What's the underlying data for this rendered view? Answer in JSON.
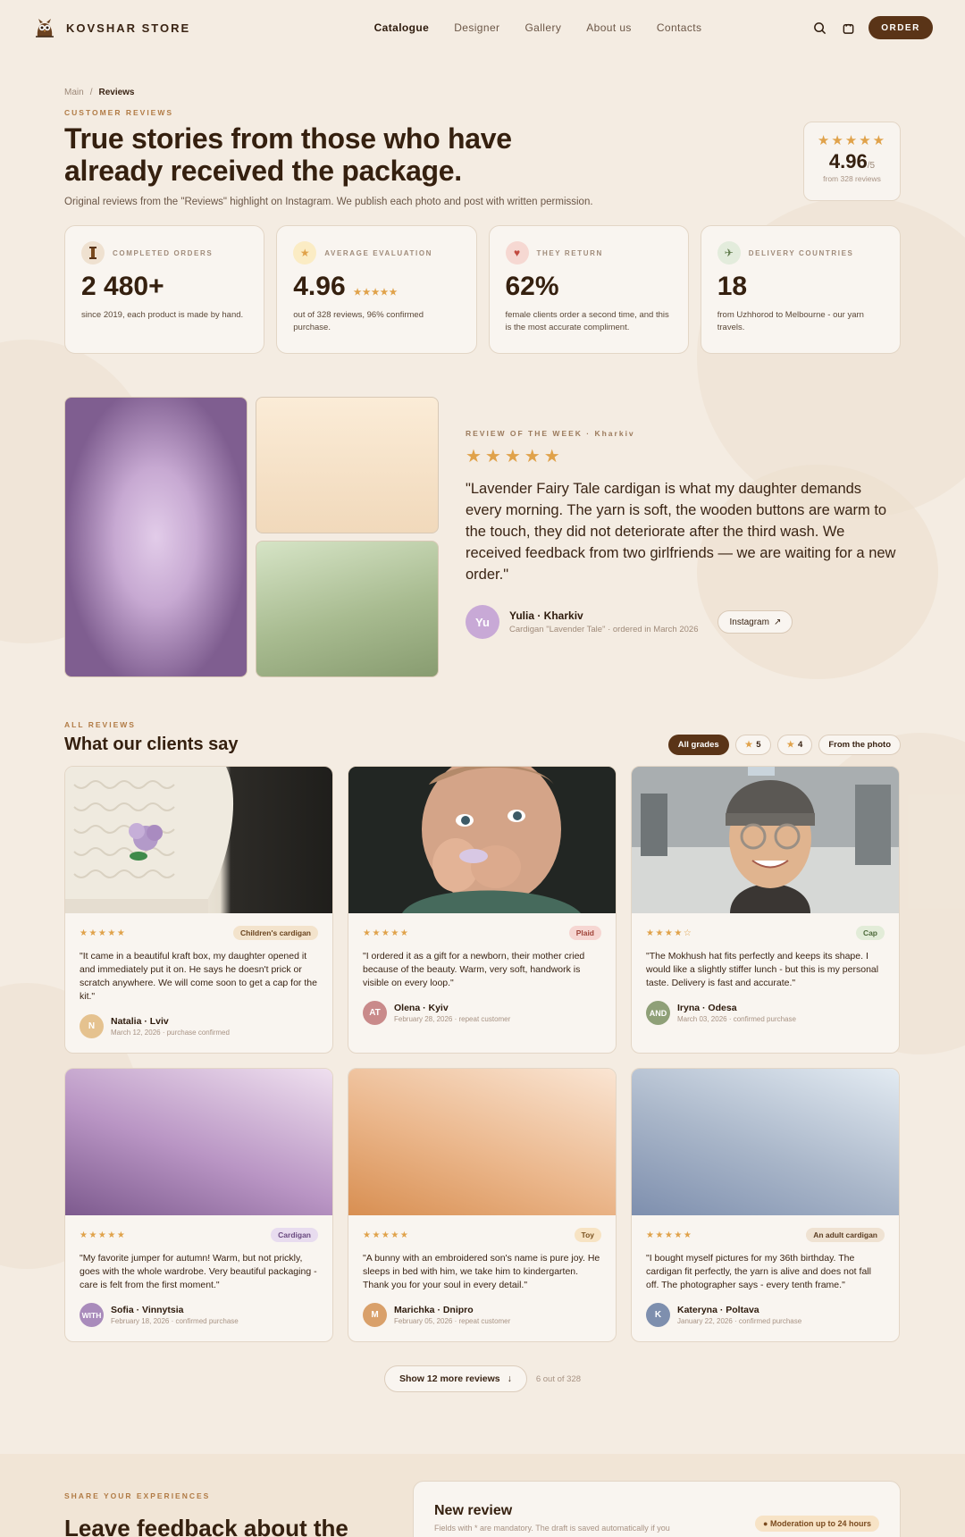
{
  "header": {
    "brand": "KOVSHAR STORE",
    "nav": [
      "Catalogue",
      "Designer",
      "Gallery",
      "About us",
      "Contacts"
    ],
    "nav_active": "Catalogue",
    "order_label": "ORDER"
  },
  "breadcrumb": {
    "home": "Main",
    "separator": "/",
    "current": "Reviews"
  },
  "hero": {
    "eyebrow": "CUSTOMER REVIEWS",
    "title": "True stories from those who have already received the package.",
    "subtitle": "Original reviews from the \"Reviews\" highlight on Instagram. We publish each photo and post with written permission.",
    "rating": {
      "stars": "★★★★★",
      "value": "4.96",
      "of": "/5",
      "from": "from 328 reviews"
    }
  },
  "stats": [
    {
      "label": "COMPLETED ORDERS",
      "value": "2 480+",
      "desc": "since 2019, each product is made by hand.",
      "icon": "spool-icon",
      "icon_bg": "#efe1d0"
    },
    {
      "label": "AVERAGE EVALUATION",
      "value": "4.96",
      "mini_stars": "★★★★★",
      "desc": "out of 328 reviews, 96% confirmed purchase.",
      "icon": "star-icon",
      "icon_bg": "#fbecc4"
    },
    {
      "label": "THEY RETURN",
      "value": "62%",
      "desc": "female clients order a second time, and this is the most accurate compliment.",
      "icon": "heart-icon",
      "icon_bg": "#f6d8d2"
    },
    {
      "label": "DELIVERY COUNTRIES",
      "value": "18",
      "desc": "from Uzhhorod to Melbourne - our yarn travels.",
      "icon": "plane-icon",
      "icon_bg": "#e3ecdc"
    }
  ],
  "featured": {
    "eyebrow": "REVIEW OF THE WEEK · Kharkiv",
    "stars": "★★★★★",
    "quote": "\"Lavender Fairy Tale cardigan is what my daughter demands every morning. The yarn is soft, the wooden buttons are warm to the touch, they did not deteriorate after the third wash. We received feedback from two girlfriends — we are waiting for a new order.\"",
    "avatar": "Yu",
    "name": "Yulia · Kharkiv",
    "meta": "Cardigan \"Lavender Tale\" · ordered in March 2026",
    "instagram_label": "Instagram"
  },
  "all_reviews": {
    "eyebrow": "ALL REVIEWS",
    "title": "What our clients say",
    "filters": [
      {
        "label": "All grades",
        "active": true,
        "star": ""
      },
      {
        "label": "5",
        "active": false,
        "star": "★"
      },
      {
        "label": "4",
        "active": false,
        "star": "★"
      },
      {
        "label": "From the photo",
        "active": false,
        "star": ""
      }
    ]
  },
  "reviews": [
    {
      "stars": "★★★★★",
      "tag": "Children's cardigan",
      "tag_bg": "#f3e3cc",
      "tag_color": "#6b4520",
      "quote": "\"It came in a beautiful kraft box, my daughter opened it and immediately put it on. He says he doesn't prick or scratch anywhere. We will come soon to get a cap for the kit.\"",
      "avatar": "N",
      "avatar_bg": "#e5c28f",
      "name": "Natalia · Lviv",
      "meta": "March 12, 2026 · purchase confirmed",
      "image": "knit-hat-photo"
    },
    {
      "stars": "★★★★★",
      "tag": "Plaid",
      "tag_bg": "#f6d6d2",
      "tag_color": "#a0443a",
      "quote": "\"I ordered it as a gift for a newborn, their mother cried because of the beauty. Warm, very soft, handwork is visible on every loop.\"",
      "avatar": "AT",
      "avatar_bg": "#c98a8a",
      "name": "Olena · Kyiv",
      "meta": "February 28, 2026 · repeat customer",
      "image": "child-photo"
    },
    {
      "stars": "★★★★☆",
      "tag": "Cap",
      "tag_bg": "#e2ecd8",
      "tag_color": "#4d6a3a",
      "quote": "\"The Mokhush hat fits perfectly and keeps its shape. I would like a slightly stiffer lunch - but this is my personal taste. Delivery is fast and accurate.\"",
      "avatar": "AND",
      "avatar_bg": "#8fa078",
      "name": "Iryna · Odesa",
      "meta": "March 03, 2026 · confirmed purchase",
      "image": "woman-hat-photo"
    },
    {
      "stars": "★★★★★",
      "tag": "Cardigan",
      "tag_bg": "#e8dcef",
      "tag_color": "#6a4a80",
      "quote": "\"My favorite jumper for autumn! Warm, but not prickly, goes with the whole wardrobe. Very beautiful packaging - care is felt from the first moment.\"",
      "avatar": "WITH",
      "avatar_bg": "#a98bbb",
      "name": "Sofia · Vinnytsia",
      "meta": "February 18, 2026 · confirmed purchase",
      "image": "lilac-gradient"
    },
    {
      "stars": "★★★★★",
      "tag": "Toy",
      "tag_bg": "#f7e3c3",
      "tag_color": "#7a5220",
      "quote": "\"A bunny with an embroidered son's name is pure joy. He sleeps in bed with him, we take him to kindergarten. Thank you for your soul in every detail.\"",
      "avatar": "M",
      "avatar_bg": "#d9a06a",
      "name": "Marichka · Dnipro",
      "meta": "February 05, 2026 · repeat customer",
      "image": "peach-gradient"
    },
    {
      "stars": "★★★★★",
      "tag": "An adult cardigan",
      "tag_bg": "#efe2d2",
      "tag_color": "#5b3d22",
      "quote": "\"I bought myself pictures for my 36th birthday. The cardigan fit perfectly, the yarn is alive and does not fall off. The photographer says - every tenth frame.\"",
      "avatar": "K",
      "avatar_bg": "#7e8fae",
      "name": "Kateryna · Poltava",
      "meta": "January 22, 2026 · confirmed purchase",
      "image": "blue-gradient"
    }
  ],
  "more": {
    "label": "Show 12 more reviews",
    "count": "6 out of 328"
  },
  "share": {
    "eyebrow": "SHARE YOUR EXPERIENCES",
    "title": "Leave feedback about the",
    "form_title": "New review",
    "form_sub": "Fields with * are mandatory. The draft is saved automatically if you",
    "badge": "Moderation up to 24 hours"
  }
}
